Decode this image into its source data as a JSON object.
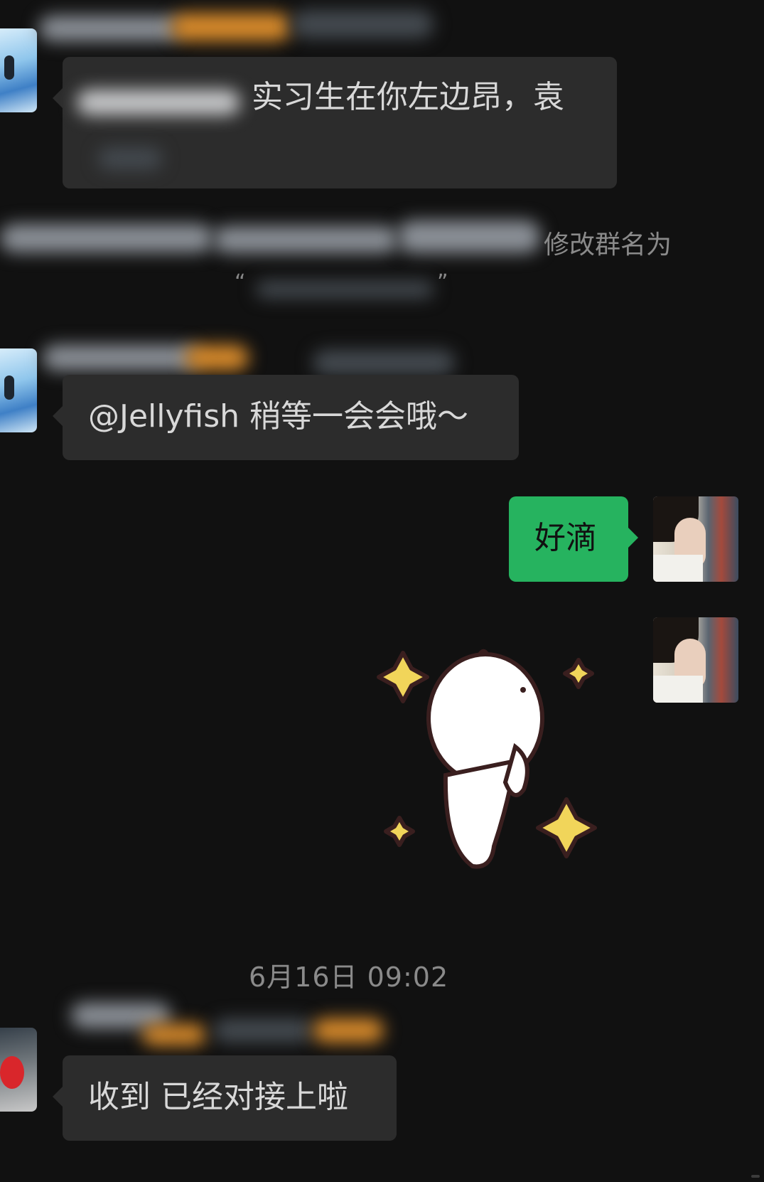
{
  "messages": {
    "msg1": {
      "text": "实习生在你左边昂，袁"
    },
    "system_rename": {
      "text": "修改群名为",
      "quote_open": "“",
      "quote_close": "”"
    },
    "msg2": {
      "text": "@Jellyfish 稍等一会会哦～"
    },
    "msg3": {
      "text": "好滴"
    },
    "sticker": {
      "name": "rabbit-sparkle-sticker"
    },
    "timestamp": "6月16日 09:02",
    "msg4": {
      "text": "收到 已经对接上啦"
    }
  },
  "colors": {
    "background": "#111111",
    "bubble_other": "#2c2c2c",
    "bubble_self": "#26b35f",
    "system_text": "#8a8a8a"
  }
}
